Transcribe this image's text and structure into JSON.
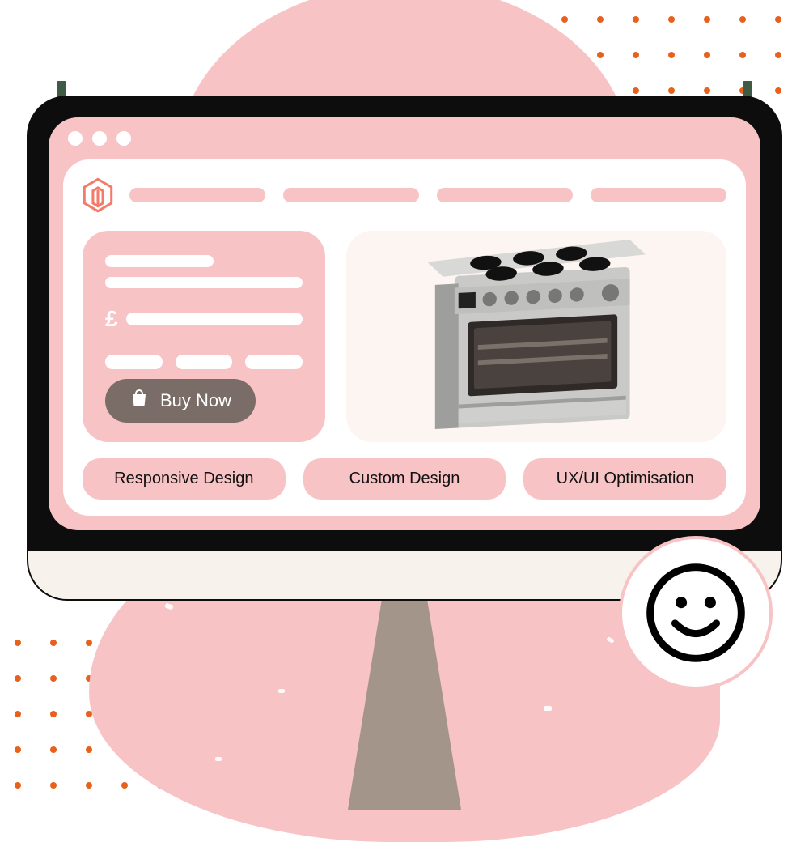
{
  "currency_symbol": "£",
  "buy": {
    "label": "Buy Now"
  },
  "features": {
    "a": "Responsive Design",
    "b": "Custom Design",
    "c": "UX/UI Optimisation"
  },
  "icons": {
    "logo": "magento-icon",
    "bag": "shopping-bag-icon",
    "smiley": "smiley-face-icon",
    "product": "stove-oven"
  }
}
